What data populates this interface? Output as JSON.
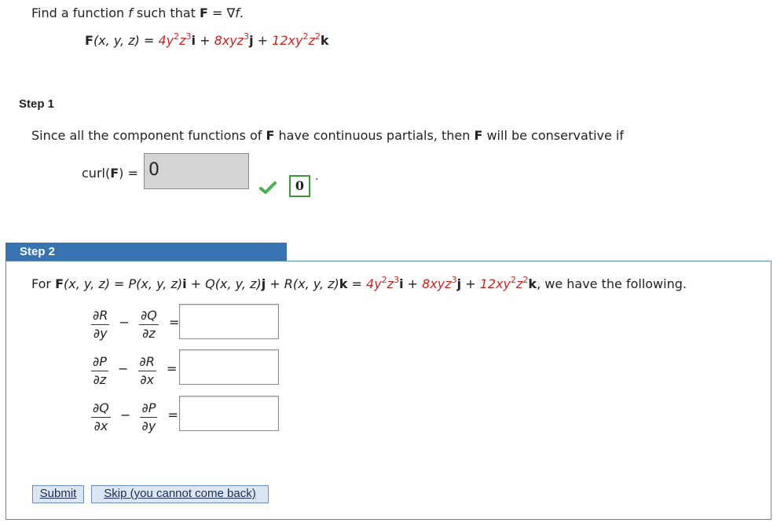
{
  "problem": {
    "prompt_prefix": "Find a function ",
    "f": "f",
    "prompt_middle": " such that ",
    "F": "F",
    "prompt_eq": " = ∇",
    "f2": "f",
    "prompt_end": ".",
    "eq_lhs_F": "F",
    "eq_lhs_args": "(x, y, z)",
    "eq_equals": " = ",
    "c1_coef": "4y",
    "c1_e1": "2",
    "c1_mid": "z",
    "c1_e2": "3",
    "i": "i",
    "plus": " + ",
    "c2_coef": "8xyz",
    "c2_e1": "3",
    "j": "j",
    "c3_coef": "12xy",
    "c3_e1": "2",
    "c3_mid": "z",
    "c3_e2": "2",
    "k": "k"
  },
  "step1": {
    "label": "Step 1",
    "text_a": "Since all the component functions of ",
    "F": "F",
    "text_b": " have continuous partials, then ",
    "F2": "F",
    "text_c": " will be conservative if",
    "curl_a": "curl(",
    "curl_F": "F",
    "curl_b": ") = ",
    "answer_value": "0",
    "check_icon": "check-icon",
    "correct_answer": "0",
    "period": "."
  },
  "step2": {
    "label": "Step 2",
    "for": "For  ",
    "F": "F",
    "args": "(x, y, z) = ",
    "P": "P(x, y, z)",
    "i": "i",
    "plus": " + ",
    "Q": "Q(x, y, z)",
    "j": "j",
    "R": "R(x, y, z)",
    "k": "k",
    "eq": " = ",
    "c1_coef": "4y",
    "c1_e1": "2",
    "c1_mid": "z",
    "c1_e2": "3",
    "c2_coef": "8xyz",
    "c2_e1": "3",
    "c3_coef": "12xy",
    "c3_e1": "2",
    "c3_mid": "z",
    "c3_e2": "2",
    "comma": ",",
    "tail": "  we have the following.",
    "rows": [
      {
        "n1": "∂R",
        "d1": "∂y",
        "n2": "∂Q",
        "d2": "∂z",
        "minus": "−",
        "eq": "=",
        "value": ""
      },
      {
        "n1": "∂P",
        "d1": "∂z",
        "n2": "∂R",
        "d2": "∂x",
        "minus": "−",
        "eq": "=",
        "value": ""
      },
      {
        "n1": "∂Q",
        "d1": "∂x",
        "n2": "∂P",
        "d2": "∂y",
        "minus": "−",
        "eq": "=",
        "value": ""
      }
    ],
    "submit_label": "Submit",
    "skip_label": "Skip (you cannot come back)"
  },
  "colors": {
    "accent_red": "#d02020",
    "step_header_blue": "#3673b0",
    "check_green": "#3a9a3a"
  }
}
